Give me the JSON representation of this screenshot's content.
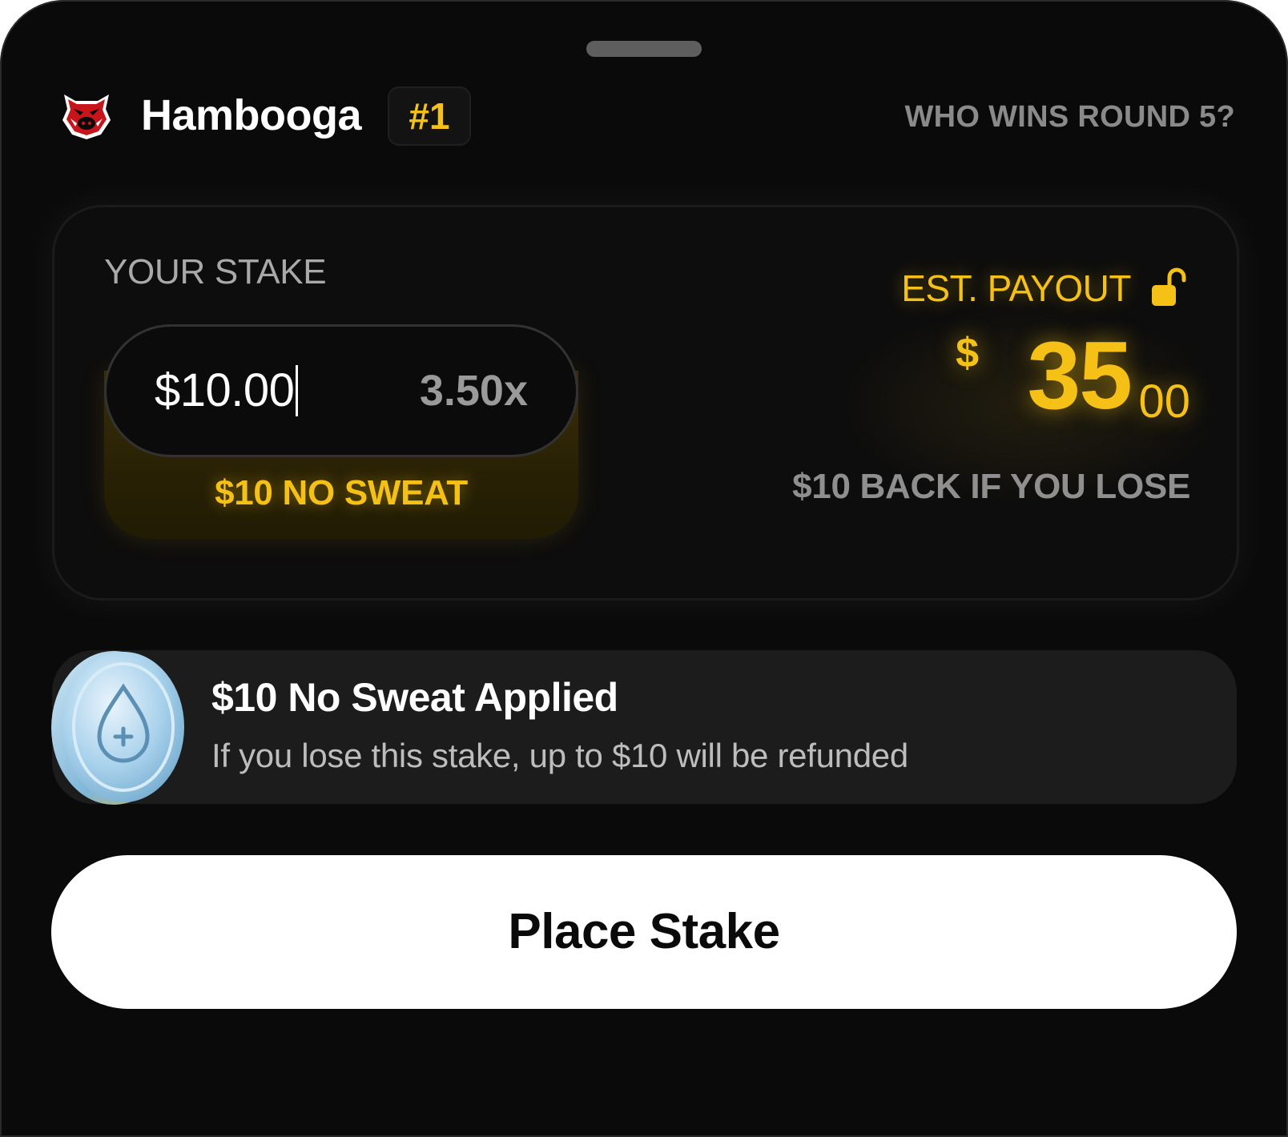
{
  "header": {
    "team_logo_icon": "boar-mascot-icon",
    "team_name": "Hambooga",
    "rank": "#1",
    "question": "WHO WINS ROUND 5?"
  },
  "stake": {
    "label": "YOUR STAKE",
    "amount": "$10.00",
    "odds": "3.50x",
    "promo": "$10 NO SWEAT"
  },
  "payout": {
    "label": "EST. PAYOUT",
    "lock_icon": "unlocked-padlock-icon",
    "currency": "$",
    "whole": "35",
    "cents": "00",
    "refund_note": "$10 BACK IF YOU LOSE"
  },
  "applied": {
    "coin_icon": "no-sweat-coin-icon",
    "title": "$10 No Sweat Applied",
    "description": "If you lose this stake, up to $10 will be refunded"
  },
  "actions": {
    "place_stake": "Place Stake"
  },
  "colors": {
    "accent": "#f5c116",
    "background": "#0a0a0a",
    "card": "#0d0d0d",
    "bar": "#1c1c1c",
    "button": "#ffffff"
  }
}
